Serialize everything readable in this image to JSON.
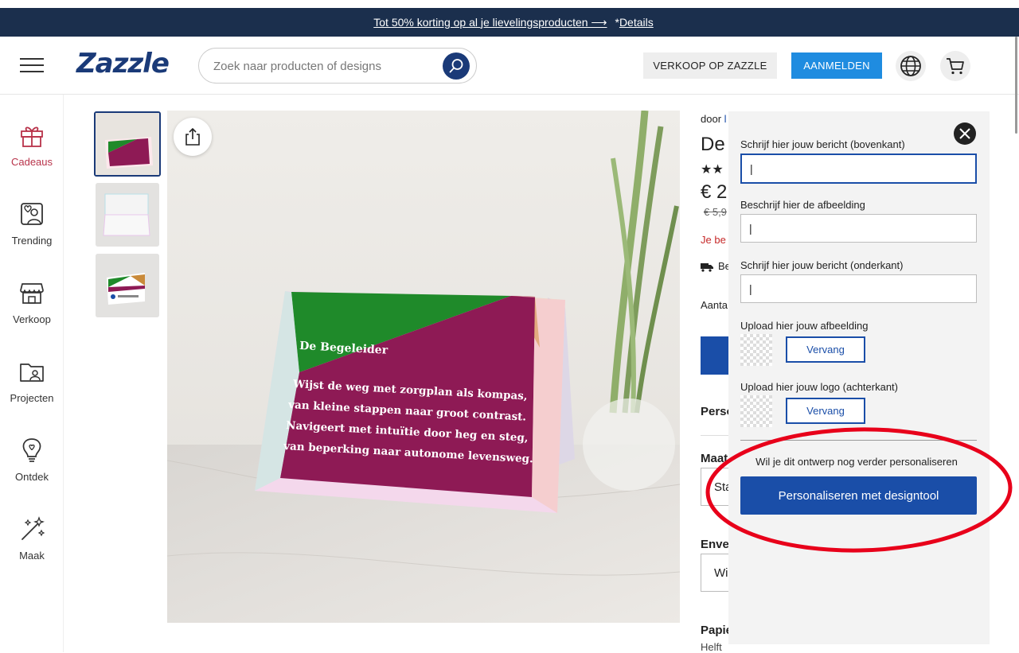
{
  "promo": {
    "main_link": "Tot 50% korting op al je lievelingsproducten ⟶",
    "details_prefix": "*",
    "details_link": "Details"
  },
  "header": {
    "logo": "Zazzle",
    "search_placeholder": "Zoek naar producten of designs",
    "sell_label": "VERKOOP OP ZAZZLE",
    "signin_label": "AANMELDEN"
  },
  "sidebar": {
    "items": [
      {
        "label": "Cadeaus",
        "icon": "gift-icon"
      },
      {
        "label": "Trending",
        "icon": "trending-icon"
      },
      {
        "label": "Verkoop",
        "icon": "store-icon"
      },
      {
        "label": "Projecten",
        "icon": "folder-icon"
      },
      {
        "label": "Ontdek",
        "icon": "lightbulb-icon"
      },
      {
        "label": "Maak",
        "icon": "magic-wand-icon"
      }
    ]
  },
  "product": {
    "card_title": "De Begeleider",
    "card_lines": [
      "Wijst de weg met zorgplan als kompas,",
      "van kleine stappen naar groot contrast.",
      "Navigeert met intuïtie door heg en steg,",
      "van beperking naar autonome levensweg."
    ],
    "by_prefix": "door",
    "title_partial": "De",
    "price_partial": "€ 2",
    "old_price_partial": "€ 5,9",
    "sale_note_partial": "Je be",
    "delivery_partial": "Be",
    "quantity_partial": "Aanta",
    "personalize_partial": "Perso",
    "size_partial": "Maat",
    "size_select_partial": "Sta",
    "envelope_partial": "Enve",
    "envelope_select_partial": "Wi",
    "paper_partial": "Papie",
    "paper_sub_partial": "Helft"
  },
  "personalize_panel": {
    "fields": [
      {
        "label": "Schrijf hier jouw bericht (bovenkant)",
        "value": "|"
      },
      {
        "label": "Beschrijf hier de afbeelding",
        "value": "|"
      },
      {
        "label": "Schrijf hier jouw bericht (onderkant)",
        "value": "|"
      }
    ],
    "uploads": [
      {
        "label": "Upload hier jouw afbeelding",
        "button": "Vervang"
      },
      {
        "label": "Upload hier jouw logo (achterkant)",
        "button": "Vervang"
      }
    ],
    "more_question": "Wil je dit ontwerp nog verder personaliseren",
    "design_tool_button": "Personaliseren met designtool"
  },
  "colors": {
    "brand": "#1a3a78",
    "promo_bg": "#1b2f4d",
    "accent_blue": "#1a4ea8",
    "signin_blue": "#1f8ce0",
    "annotation_red": "#e8001a",
    "card_green": "#1f8a2a",
    "card_magenta": "#8e1a55",
    "card_orange": "#c98a3a"
  }
}
